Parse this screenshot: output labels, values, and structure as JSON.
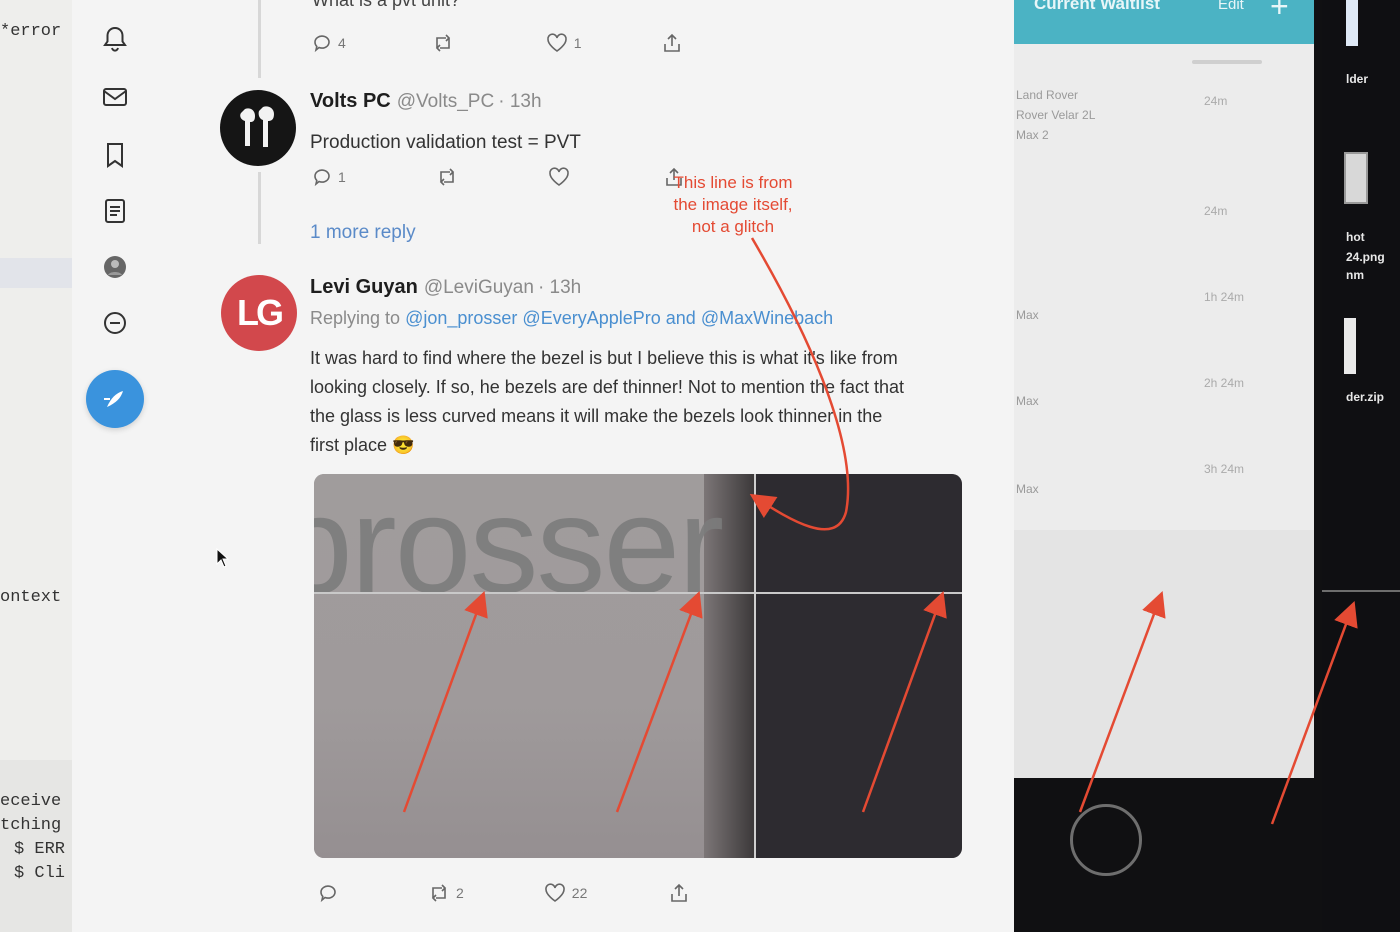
{
  "terminal": {
    "lines": [
      "*error",
      "ontext",
      "eceive",
      "tching",
      "$ ERR",
      "$ Cli"
    ]
  },
  "sidebar": {
    "items": [
      {
        "name": "notifications",
        "icon": "bell-icon"
      },
      {
        "name": "messages",
        "icon": "envelope-icon"
      },
      {
        "name": "bookmarks",
        "icon": "bookmark-icon"
      },
      {
        "name": "lists",
        "icon": "list-icon"
      },
      {
        "name": "profile",
        "icon": "avatar-icon"
      },
      {
        "name": "more",
        "icon": "more-circle-icon"
      }
    ],
    "compose_icon": "feather-compose-icon",
    "accent": "#3a93dd"
  },
  "thread": {
    "top_tweet": {
      "text": "What is a pvt unit?",
      "reply_count": "4",
      "retweet_count": "",
      "like_count": "1"
    },
    "volts_tweet": {
      "name": "Volts PC",
      "handle": "@Volts_PC",
      "time": "· 13h",
      "text": "Production validation test = PVT",
      "reply_count": "1",
      "retweet_count": "",
      "like_count": ""
    },
    "more_replies": "1 more reply",
    "levi_tweet": {
      "name": "Levi Guyan",
      "handle": "@LeviGuyan",
      "time": "· 13h",
      "avatar_text": "LG",
      "replying_prefix": "Replying to",
      "mention_1": "@jon_prosser",
      "mention_2": "@EveryApplePro",
      "and_word": "and",
      "mention_3": "@MaxWinebach",
      "text_lines": [
        "It was hard to find where the bezel is but I believe this is what it's like from",
        "looking closely. If so, he bezels are def thinner! Not to mention the fact that",
        "the glass is less curved means it will make the bezels look thinner in the",
        "first place 😎"
      ],
      "image_word": "prosser",
      "reply_count": "",
      "retweet_count": "2",
      "like_count": "22"
    }
  },
  "annotation": {
    "note_lines": [
      "This line is from",
      "the image itself,",
      "not a glitch"
    ],
    "color": "#e44a33"
  },
  "phone": {
    "header_title": "Current Waitlist",
    "header_edit": "Edit",
    "header_add": "+",
    "rows": [
      {
        "title": "Land Rover",
        "subtitle": "Rover Velar 2L",
        "extra": "Max 2",
        "time": "24m"
      },
      {
        "title": "",
        "subtitle": "",
        "extra": "",
        "time": "24m"
      },
      {
        "title": "Max",
        "subtitle": "",
        "extra": "",
        "time": "1h 24m"
      },
      {
        "title": "Max",
        "subtitle": "",
        "extra": "",
        "time": "2h 24m"
      },
      {
        "title": "Max",
        "subtitle": "",
        "extra": "",
        "time": "3h 24m"
      }
    ]
  },
  "desktop": {
    "files": [
      {
        "label": "lder",
        "icon": "folder-icon"
      },
      {
        "label": "hot",
        "icon": "image-file-icon"
      },
      {
        "label": "24.png",
        "icon": ""
      },
      {
        "label": "nm",
        "icon": ""
      },
      {
        "label": "der.zip",
        "icon": "zip-file-icon"
      }
    ]
  }
}
